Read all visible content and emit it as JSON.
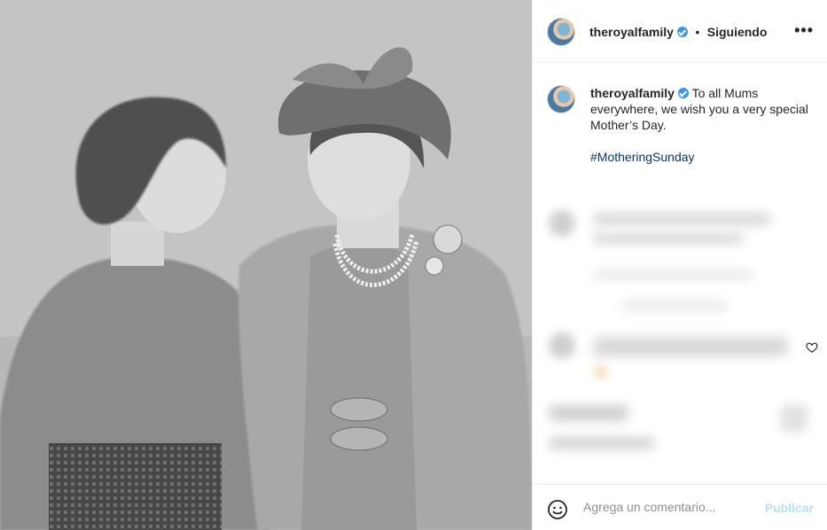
{
  "post": {
    "image_alt": "Black and white photo of a girl and a woman in a hat smiling at each other"
  },
  "header": {
    "username": "theroyalfamily",
    "separator": "•",
    "follow_status": "Siguiendo",
    "more_label": "•••"
  },
  "caption": {
    "username": "theroyalfamily",
    "text": "To all Mums everywhere, we wish you a very special Mother’s Day.",
    "hashtag": "#MotheringSunday"
  },
  "comment_box": {
    "placeholder": "Agrega un comentario...",
    "publish_label": "Publicar"
  },
  "colors": {
    "link": "#00376b",
    "verified": "#3897f0",
    "publish_disabled": "#b2dffc"
  }
}
